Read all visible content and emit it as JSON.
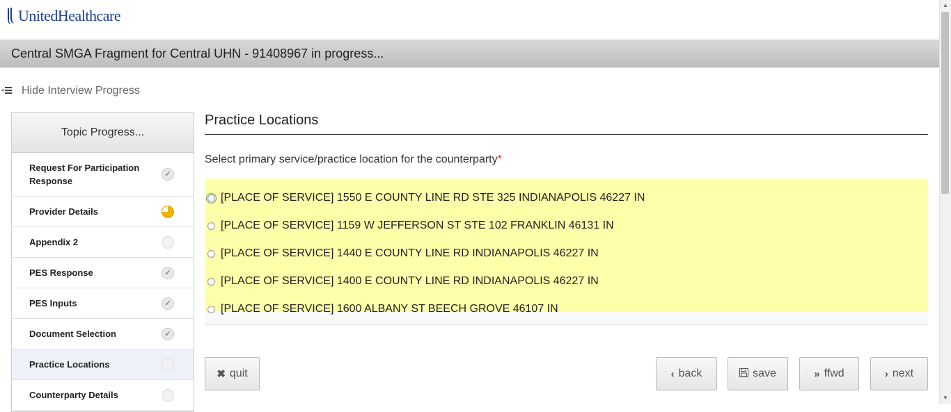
{
  "brand": {
    "logo_text": "UnitedHealthcare"
  },
  "titlebar": {
    "title": "Central SMGA Fragment for Central UHN - 91408967 in progress..."
  },
  "progress_toggle": {
    "label": "Hide Interview Progress",
    "icon": "menu-collapse-icon"
  },
  "sidebar": {
    "header": "Topic Progress...",
    "topics": [
      {
        "label": "Request For Participation Response",
        "status": "complete"
      },
      {
        "label": "Provider Details",
        "status": "in-progress"
      },
      {
        "label": "Appendix 2",
        "status": "not-started"
      },
      {
        "label": "PES Response",
        "status": "complete"
      },
      {
        "label": "PES Inputs",
        "status": "complete"
      },
      {
        "label": "Document Selection",
        "status": "complete"
      },
      {
        "label": "Practice Locations",
        "status": "not-started",
        "active": true
      },
      {
        "label": "Counterparty Details",
        "status": "not-started"
      }
    ]
  },
  "main": {
    "title": "Practice Locations",
    "question": "Select primary service/practice location for the counterparty",
    "required_marker": "*",
    "options": [
      "[PLACE OF SERVICE] 1550 E COUNTY LINE RD STE 325 INDIANAPOLIS 46227 IN",
      "[PLACE OF SERVICE] 1159 W JEFFERSON ST STE 102 FRANKLIN 46131 IN",
      "[PLACE OF SERVICE] 1440 E COUNTY LINE RD INDIANAPOLIS 46227 IN",
      "[PLACE OF SERVICE] 1400 E COUNTY LINE RD INDIANAPOLIS 46227 IN",
      "[PLACE OF SERVICE] 1600 ALBANY ST BEECH GROVE 46107 IN"
    ],
    "highlight_color": "#ffffaa"
  },
  "buttons": {
    "quit": {
      "label": "quit",
      "icon": "close-icon"
    },
    "back": {
      "label": "back",
      "icon": "chevron-left-icon"
    },
    "save": {
      "label": "save",
      "icon": "floppy-disk-icon"
    },
    "ffwd": {
      "label": "ffwd",
      "icon": "double-chevron-right-icon"
    },
    "next": {
      "label": "next",
      "icon": "chevron-right-icon"
    }
  }
}
